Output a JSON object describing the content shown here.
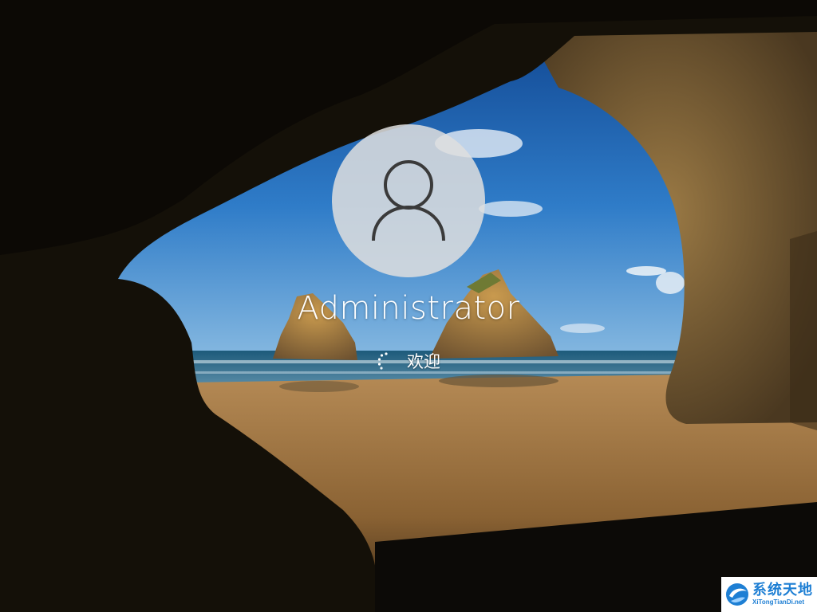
{
  "login": {
    "username": "Administrator",
    "status_text": "欢迎",
    "avatar_icon": "user-icon",
    "spinner_icon": "loading-spinner-icon"
  },
  "watermark": {
    "title": "系统天地",
    "subtitle": "XiTongTianDi.net",
    "logo_icon": "xitongtiandi-logo-icon"
  },
  "colors": {
    "text": "#ffffff",
    "avatar_bg": "#dedede",
    "avatar_glyph": "#3a3a3a",
    "watermark_accent": "#1e7fd4"
  }
}
